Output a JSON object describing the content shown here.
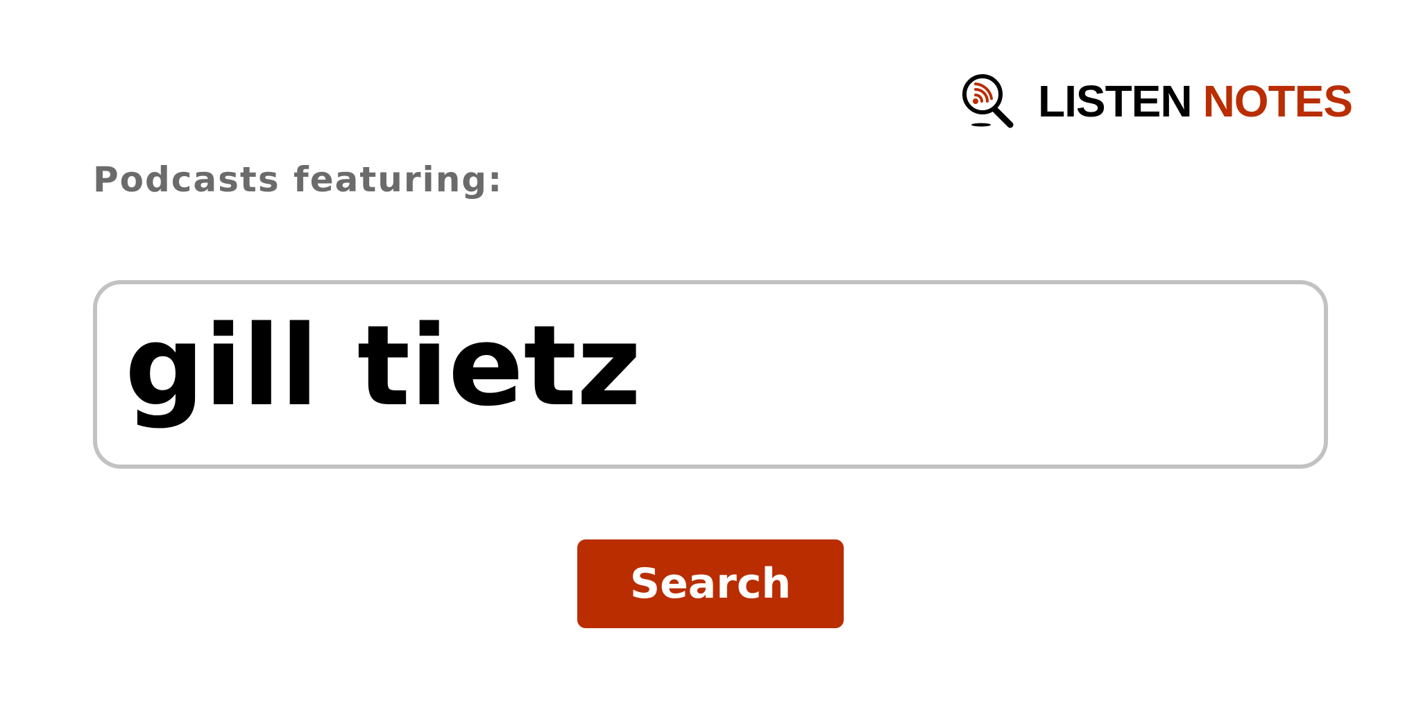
{
  "header": {
    "logo": {
      "icon": "podcast-search-icon",
      "word_1": "LISTEN",
      "word_2": "NOTES",
      "colors": {
        "primary": "#000000",
        "accent": "#b92d00"
      }
    }
  },
  "main": {
    "heading": "Podcasts featuring:",
    "search": {
      "value": "gill tietz",
      "placeholder": ""
    },
    "search_button": {
      "label": "Search",
      "color": "#b92d00"
    }
  }
}
